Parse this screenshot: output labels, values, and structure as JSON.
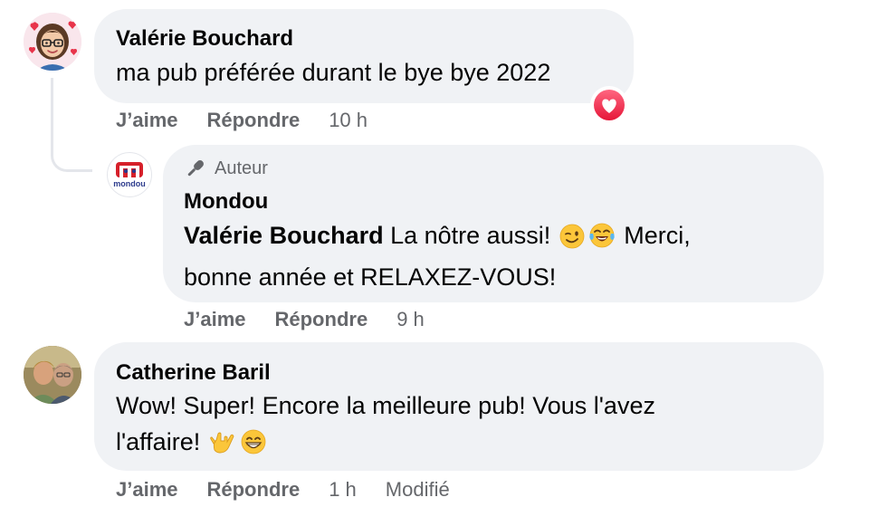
{
  "comments": [
    {
      "author": "Valérie Bouchard",
      "text": "ma pub préférée durant le bye bye 2022",
      "like_label": "J’aime",
      "reply_label": "Répondre",
      "time": "10 h",
      "reaction": "love-reaction-icon"
    },
    {
      "badge": "Auteur",
      "author": "Mondou",
      "logo_text": "mondou",
      "mention": "Valérie Bouchard",
      "text_line1": " La nôtre aussi! ",
      "text_line1_end": " Merci,",
      "text_line2": "bonne année et RELAXEZ-VOUS!",
      "emojis": [
        "winking-face-emoji",
        "face-with-tears-of-joy-emoji"
      ],
      "like_label": "J’aime",
      "reply_label": "Répondre",
      "time": "9 h"
    },
    {
      "author": "Catherine Baril",
      "text_line1": "Wow! Super! Encore la meilleure pub! Vous l'avez",
      "text_line2": "l'affaire!",
      "emojis": [
        "love-you-gesture-emoji",
        "grinning-face-emoji"
      ],
      "like_label": "J’aime",
      "reply_label": "Répondre",
      "time": "1 h",
      "edited": "Modifié"
    }
  ],
  "colors": {
    "bubble": "#f0f2f5",
    "meta_text": "#65676b",
    "love_reaction": "#f33e58",
    "mondou_brand": "#d6202a",
    "mondou_blue": "#2b3a8c"
  }
}
